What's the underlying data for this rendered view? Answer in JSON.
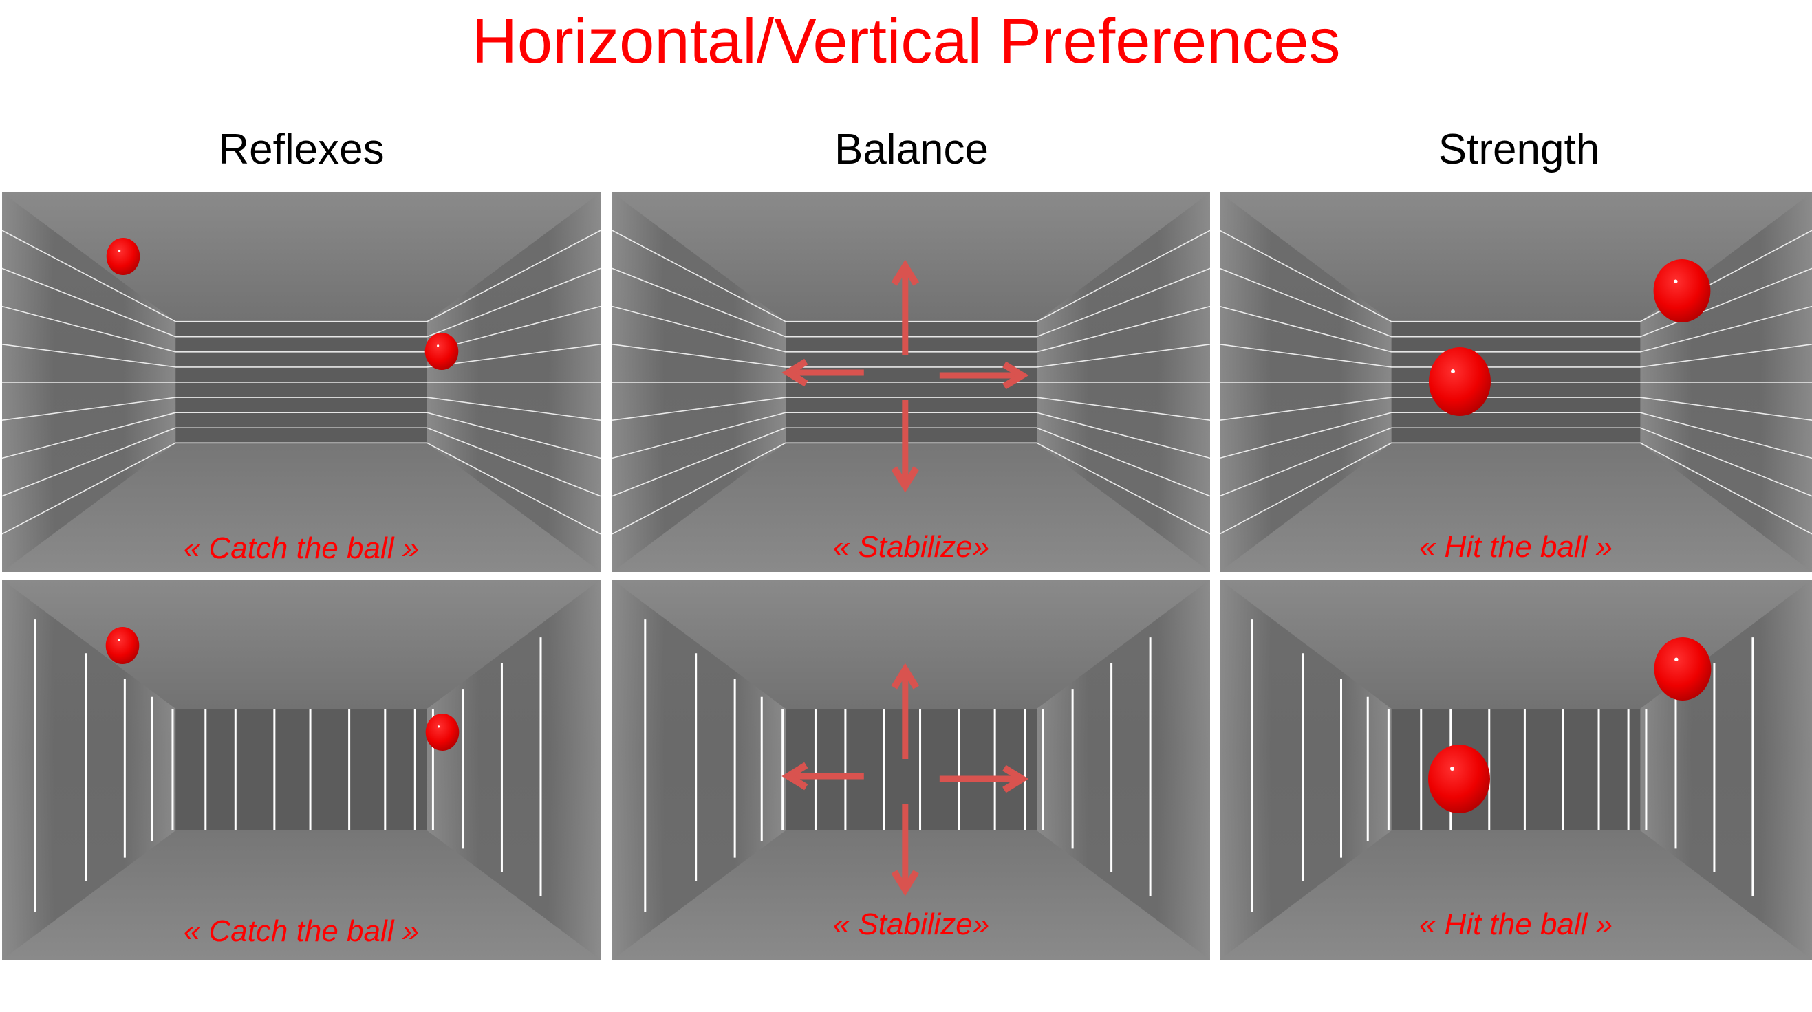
{
  "title": "Horizontal/Vertical Preferences",
  "columns": [
    {
      "heading": "Reflexes",
      "task": "« Catch the ball »",
      "stimulus": "red-balls"
    },
    {
      "heading": "Balance",
      "task": "« Stabilize»",
      "stimulus": "four-direction-arrows"
    },
    {
      "heading": "Strength",
      "task": "« Hit the ball »",
      "stimulus": "red-balls"
    }
  ],
  "rows": [
    {
      "line_orientation": "horizontal",
      "captions": [
        "« Catch the ball »",
        "« Stabilize»",
        "« Hit the ball »"
      ]
    },
    {
      "line_orientation": "vertical",
      "captions": [
        "« Catch the ball »",
        "« Stabilize»",
        "« Hit the ball »"
      ]
    }
  ],
  "colors": {
    "title": "#ff0000",
    "caption": "#ff0000",
    "ball": "#ee0000",
    "arrow": "#d9534f",
    "room_dark": "#5a5a5a",
    "room_light": "#8a8a8a",
    "lines": "#ffffff"
  }
}
